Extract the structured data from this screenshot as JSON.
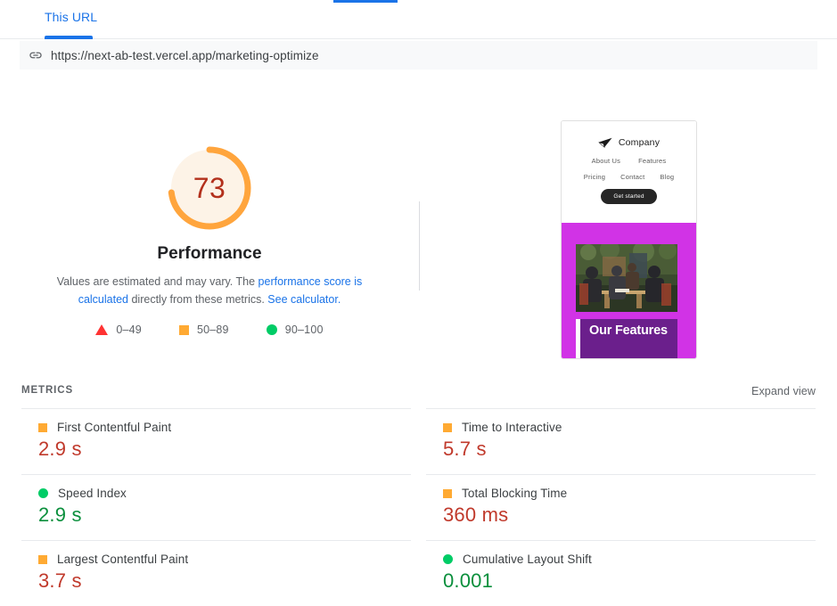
{
  "top_fragment": {
    "color": "#1a73e8"
  },
  "tabs": {
    "active_label": "This URL",
    "active_color": "#1a73e8"
  },
  "url_bar": {
    "icon": "link-icon",
    "url": "https://next-ab-test.vercel.app/marketing-optimize"
  },
  "score": {
    "value": "73",
    "category": "Performance",
    "arc_percent": 73,
    "arc_color": "#ffa53d",
    "track_color": "#fdf3e7",
    "value_color": "#b3301c",
    "description_prefix": "Values are estimated and may vary. The ",
    "description_link1": "performance score is calculated",
    "description_middle": " directly from these metrics. ",
    "description_link2": "See calculator.",
    "link_color": "#1a73e8"
  },
  "legend": [
    {
      "shape": "triangle-icon",
      "label": "0–49",
      "color": "#ff3333"
    },
    {
      "shape": "square-icon",
      "label": "50–89",
      "color": "#ffaa33"
    },
    {
      "shape": "circle-icon",
      "label": "90–100",
      "color": "#00cc66"
    }
  ],
  "thumbnail": {
    "brand": "Company",
    "logo": "paper-plane-icon",
    "nav_row1": [
      "About Us",
      "Features"
    ],
    "nav_row2": [
      "Pricing",
      "Contact",
      "Blog"
    ],
    "cta": "Get started",
    "hero_bg": "#d133e6",
    "card_bg": "#6b1f8c",
    "card_title": "Our Features"
  },
  "metrics_section": {
    "heading": "METRICS",
    "expand_label": "Expand view"
  },
  "metrics": [
    {
      "name": "First Contentful Paint",
      "value": "2.9 s",
      "marker": "square",
      "value_class": "red"
    },
    {
      "name": "Time to Interactive",
      "value": "5.7 s",
      "marker": "square",
      "value_class": "red"
    },
    {
      "name": "Speed Index",
      "value": "2.9 s",
      "marker": "circle",
      "value_class": "green"
    },
    {
      "name": "Total Blocking Time",
      "value": "360 ms",
      "marker": "square",
      "value_class": "red"
    },
    {
      "name": "Largest Contentful Paint",
      "value": "3.7 s",
      "marker": "square",
      "value_class": "red"
    },
    {
      "name": "Cumulative Layout Shift",
      "value": "0.001",
      "marker": "circle",
      "value_class": "green"
    }
  ]
}
